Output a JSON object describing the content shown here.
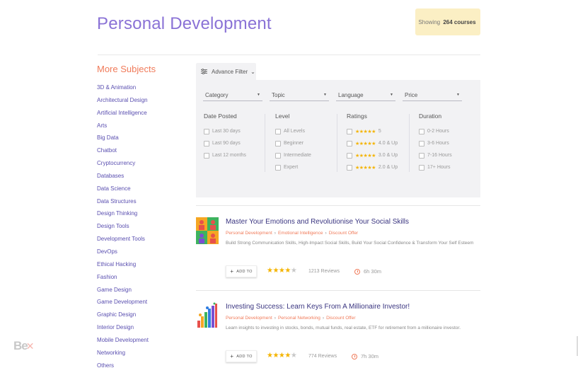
{
  "header": {
    "title": "Personal Development",
    "showing_prefix": "Showing",
    "showing_count": "264 courses"
  },
  "sidebar": {
    "title": "More Subjects",
    "items": [
      "3D & Animation",
      "Architectural Design",
      "Artificial Intelligence",
      "Arts",
      "Big Data",
      "Chatbot",
      "Cryptocurrency",
      "Databases",
      "Data Science",
      "Data Structures",
      "Design Thinking",
      "Design Tools",
      "Development Tools",
      "DevOps",
      "Ethical Hacking",
      "Fashion",
      "Game Design",
      "Game Development",
      "Graphic Design",
      "Interior Design",
      "Mobile Development",
      "Networking",
      "Others"
    ]
  },
  "filter": {
    "tab_label": "Advance Filter",
    "dropdowns": [
      "Category",
      "Topic",
      "Language",
      "Price"
    ],
    "date_posted": {
      "title": "Date Posted",
      "options": [
        "Last 30 days",
        "Last 90 days",
        "Last 12 months"
      ]
    },
    "level": {
      "title": "Level",
      "options": [
        "All Levels",
        "Beginner",
        "Intermediate",
        "Expert"
      ]
    },
    "ratings": {
      "title": "Ratings",
      "options": [
        "5",
        "4.0 & Up",
        "3.0 & Up",
        "2.0 & Up"
      ]
    },
    "duration": {
      "title": "Duration",
      "options": [
        "0-2 Hours",
        "3-6 Hours",
        "7-16 Hours",
        "17+ Hours"
      ]
    }
  },
  "courses": [
    {
      "title": "Master Your Emotions and Revolutionise Your Social Skills",
      "crumbs": [
        "Personal Development",
        "Emotional Intelligence",
        "Discount Offer"
      ],
      "description": "Build Strong Communication Skills, High-Impact Social Skills, Build Your Social Confidence & Transform Your Self Esteem",
      "add_label": "ADD TO",
      "rating": 4,
      "reviews": "1213 Reviews",
      "duration": "6h 30m"
    },
    {
      "title": "Investing Success: Learn Keys From A Millionaire Investor!",
      "crumbs": [
        "Personal Development",
        "Personal Networking",
        "Discount Offer"
      ],
      "description": "Learn insights to investing in stocks, bonds, mutual funds, real estate, ETF for retirement from a millionaire investor.",
      "add_label": "ADD TO",
      "rating": 4,
      "reviews": "774 Reviews",
      "duration": "7h 30m"
    }
  ],
  "colors": {
    "accent_purple": "#8a72d6",
    "accent_orange": "#f07b5a",
    "badge_bg": "#fbefc4",
    "star": "#f4b400"
  },
  "logo": {
    "text": "Be"
  }
}
